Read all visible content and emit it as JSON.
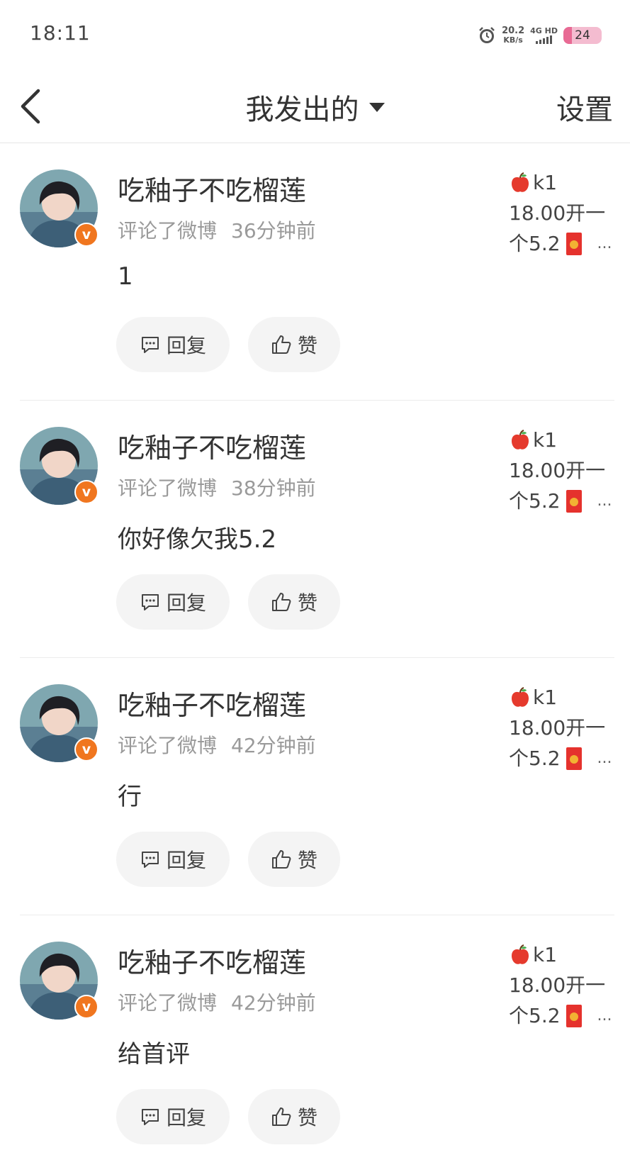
{
  "status_bar": {
    "time": "18:11",
    "net_speed_value": "20.2",
    "net_speed_unit": "KB/s",
    "signal_label": "4G HD",
    "battery": "24"
  },
  "header": {
    "title": "我发出的",
    "settings": "设置"
  },
  "comments": [
    {
      "user": "吃釉子不吃榴莲",
      "action": "评论了微博",
      "time": "36分钟前",
      "content": "1",
      "quote_line1": "k1",
      "quote_line2": "18.00开一",
      "quote_line3": "个5.2",
      "quote_more": "...",
      "reply_label": "回复",
      "like_label": "赞"
    },
    {
      "user": "吃釉子不吃榴莲",
      "action": "评论了微博",
      "time": "38分钟前",
      "content": "你好像欠我5.2",
      "quote_line1": "k1",
      "quote_line2": "18.00开一",
      "quote_line3": "个5.2",
      "quote_more": "...",
      "reply_label": "回复",
      "like_label": "赞"
    },
    {
      "user": "吃釉子不吃榴莲",
      "action": "评论了微博",
      "time": "42分钟前",
      "content": "行",
      "quote_line1": "k1",
      "quote_line2": "18.00开一",
      "quote_line3": "个5.2",
      "quote_more": "...",
      "reply_label": "回复",
      "like_label": "赞"
    },
    {
      "user": "吃釉子不吃榴莲",
      "action": "评论了微博",
      "time": "42分钟前",
      "content": "给首评",
      "quote_line1": "k1",
      "quote_line2": "18.00开一",
      "quote_line3": "个5.2",
      "quote_more": "...",
      "reply_label": "回复",
      "like_label": "赞"
    }
  ],
  "colors": {
    "verified_badge": "#f0761f",
    "battery_fill": "#e86a94",
    "red_envelope": "#e5322d"
  },
  "icons": [
    "back-arrow-icon",
    "dropdown-caret-icon",
    "alarm-icon",
    "signal-icon",
    "battery-icon",
    "verified-badge-icon",
    "comment-icon",
    "thumbs-up-icon",
    "apple-emoji-icon",
    "red-envelope-icon"
  ]
}
